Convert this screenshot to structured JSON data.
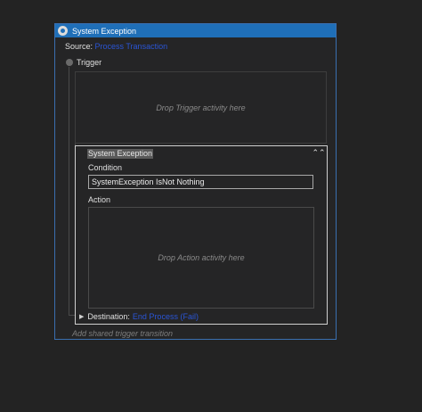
{
  "transition": {
    "title": "System Exception",
    "title_icon": "transition-icon",
    "source_label": "Source:",
    "source_link": "Process Transaction",
    "trigger_label": "Trigger",
    "trigger_drop_text": "Drop Trigger activity here",
    "add_shared_text": "Add shared trigger transition"
  },
  "panel": {
    "title": "System Exception",
    "collapse_icon": "double-chevron-up-icon",
    "condition_label": "Condition",
    "condition_value": "SystemException IsNot Nothing",
    "action_label": "Action",
    "action_drop_text": "Drop Action activity here",
    "destination_label": "Destination:",
    "destination_link": "End Process (Fail)"
  },
  "colors": {
    "background": "#232323",
    "titlebar": "#1f6fb8",
    "link": "#2a55d6",
    "border_accent": "#3a6fb0"
  }
}
